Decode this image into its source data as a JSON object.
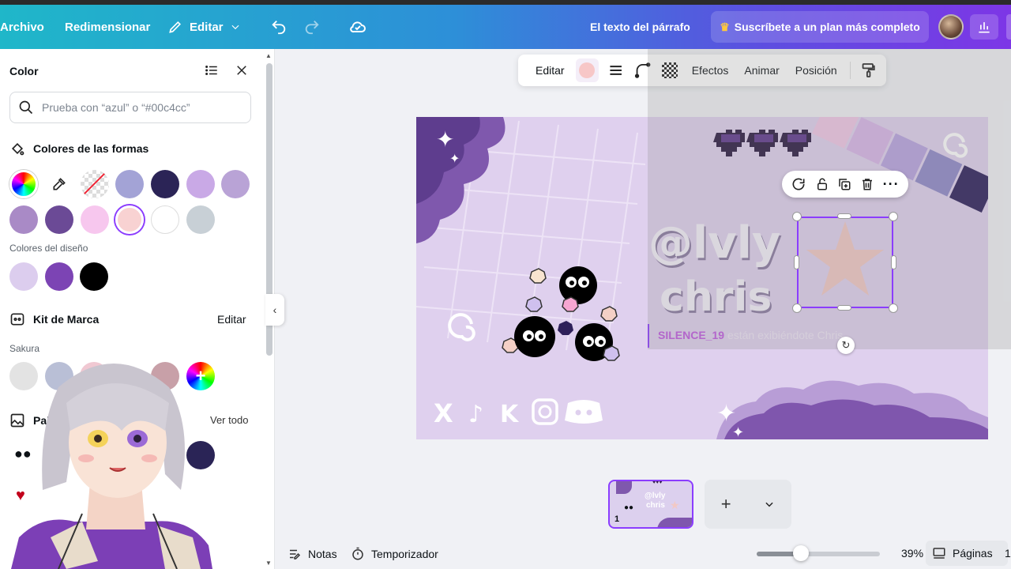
{
  "topbar": {
    "archivo": "Archivo",
    "redimensionar": "Redimensionar",
    "editar": "Editar",
    "doc_title": "El texto del párrafo",
    "subscribe": "Suscríbete a un plan más completo"
  },
  "panel": {
    "title": "Color",
    "search_placeholder": "Prueba con “azul” o “#00c4cc”",
    "shape_colors_label": "Colores de las formas",
    "shape_colors": [
      "#a3a3d6",
      "#2b2456",
      "#c9a9e6",
      "#b9a3d6",
      "#a98ac6",
      "#6b4a96",
      "#f7c7ee",
      "#f8d2d2",
      "#ffffff",
      "#c8d0d6"
    ],
    "design_colors_label": "Colores del diseño",
    "design_colors": [
      "#dccdee",
      "#7c44b4",
      "#000000"
    ],
    "brand_kit_label": "Kit de Marca",
    "brand_kit_edit": "Editar",
    "brand_name": "Sakura",
    "brand_colors": [
      "#e3e3e3",
      "#b9bfd6",
      "#f0c8d2",
      "#c8a0a8"
    ],
    "palette_label_start": "Pale",
    "palette_label_end": "os",
    "ver_todo": "Ver todo",
    "palette_color": "#2a2456"
  },
  "toolbar": {
    "editar": "Editar",
    "efectos": "Efectos",
    "animar": "Animar",
    "posicion": "Posición",
    "swatch": "#f7c7c7"
  },
  "design": {
    "handle_line1": "@lvly",
    "handle_line2": "chris",
    "chat_user": "SILENCE_19",
    "chat_msg": "están exibiéndote Chris"
  },
  "thumbnail": {
    "page_number": "1",
    "text1": "@lvly",
    "text2": "chris"
  },
  "bottom": {
    "notas": "Notas",
    "temporizador": "Temporizador",
    "zoom": "39%",
    "paginas": "Páginas",
    "page_count": "1"
  }
}
